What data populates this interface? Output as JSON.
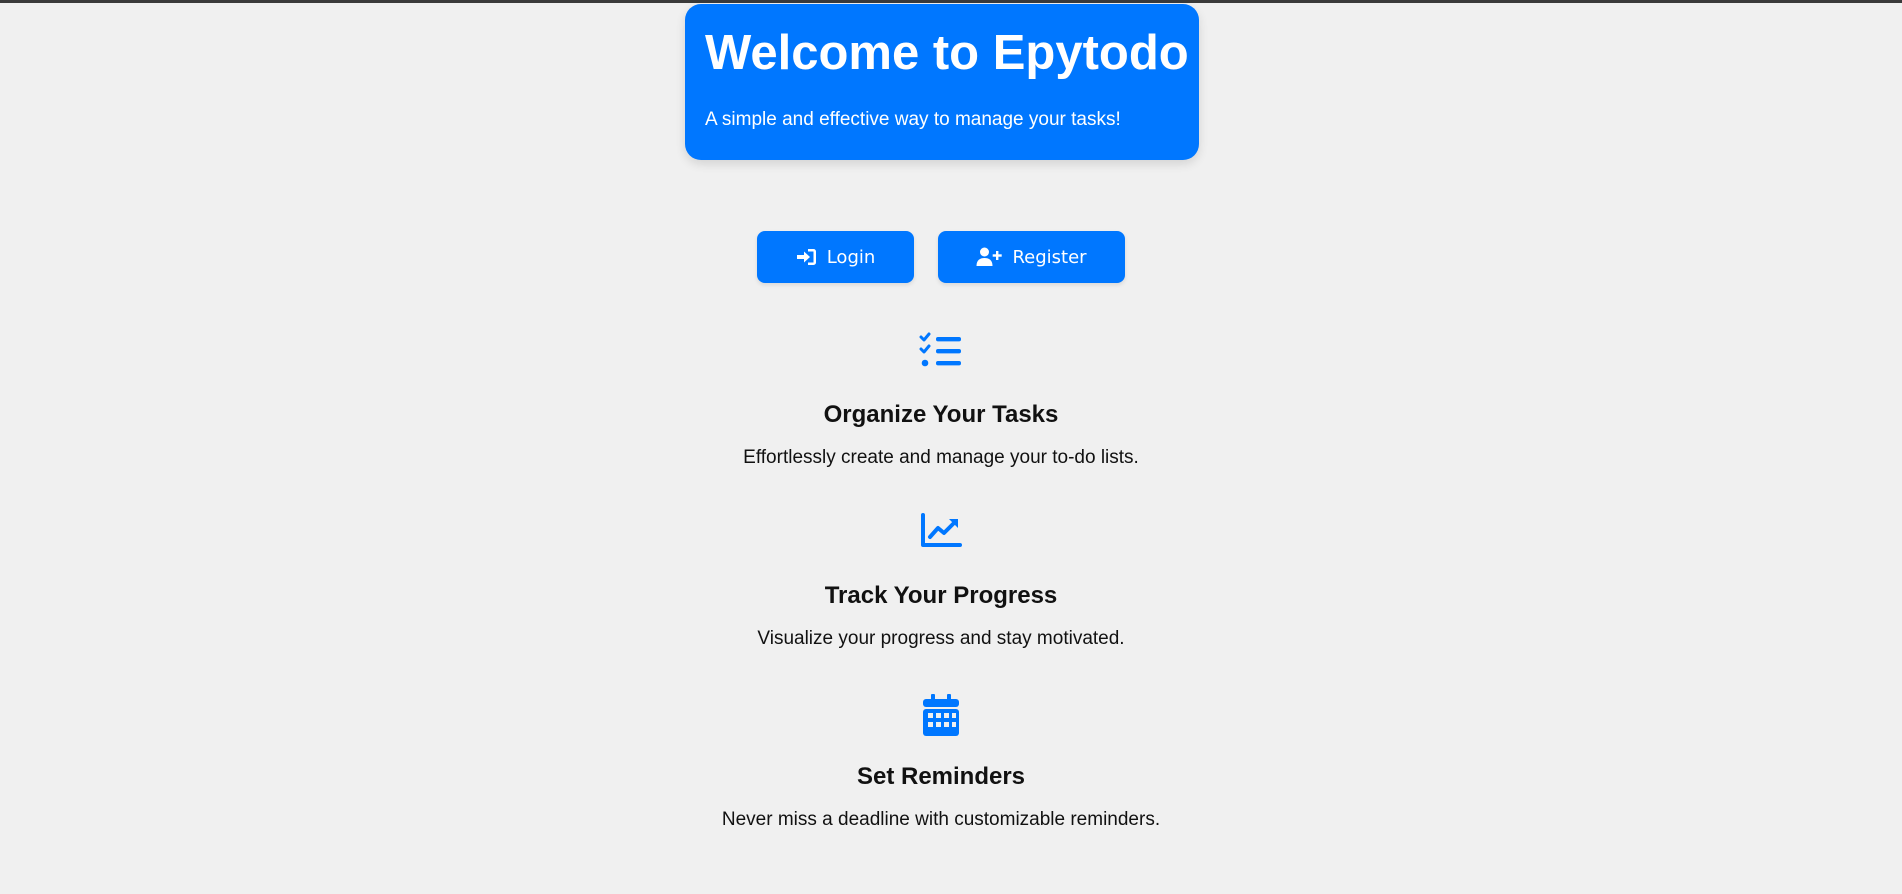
{
  "header": {
    "title": "Welcome to Epytodo",
    "subtitle": "A simple and effective way to manage your tasks!"
  },
  "actions": {
    "login_label": "Login",
    "register_label": "Register"
  },
  "features": [
    {
      "icon": "tasks-list-icon",
      "title": "Organize Your Tasks",
      "description": "Effortlessly create and manage your to-do lists."
    },
    {
      "icon": "chart-line-icon",
      "title": "Track Your Progress",
      "description": "Visualize your progress and stay motivated."
    },
    {
      "icon": "calendar-icon",
      "title": "Set Reminders",
      "description": "Never miss a deadline with customizable reminders."
    }
  ],
  "colors": {
    "accent": "#0077ff",
    "background": "#f0f0f0",
    "text": "#111111"
  }
}
